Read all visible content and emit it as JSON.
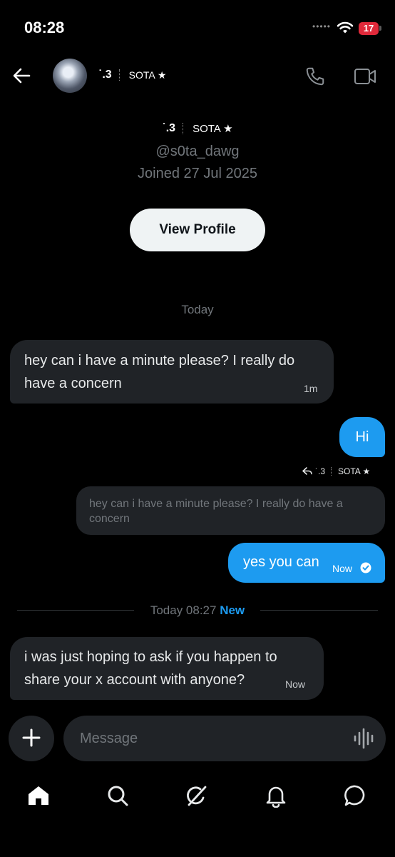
{
  "status_bar": {
    "time": "08:28",
    "battery": "17"
  },
  "header": {
    "name_part1": "˙.3",
    "name_part2": "SOTA ★"
  },
  "profile": {
    "name_part1": "˙.3",
    "name_part2": "SOTA ★",
    "handle": "@s0ta_dawg",
    "joined": "Joined 27 Jul 2025",
    "view_button": "View Profile"
  },
  "day_label": "Today",
  "messages": [
    {
      "text": "hey can i have a minute please? I really do have a concern",
      "time": "1m"
    },
    {
      "text": "Hi"
    },
    {
      "reply_to_name": "˙.3",
      "reply_to_name2": "SOTA ★",
      "quoted": "hey can i have a minute please? I really do have a concern",
      "text": "yes you can",
      "time": "Now"
    },
    {
      "text": "i was just hoping to ask if you happen to share your x account with anyone?",
      "time": "Now"
    }
  ],
  "divider": {
    "label": "Today 08:27",
    "new": "New"
  },
  "composer": {
    "placeholder": "Message"
  },
  "colors": {
    "accent": "#1d9bf0",
    "bubble_in": "#202327",
    "background": "#000000"
  },
  "icons": [
    "back-arrow-icon",
    "phone-icon",
    "video-icon",
    "plus-icon",
    "voice-wave-icon",
    "home-icon",
    "search-icon",
    "grok-icon",
    "bell-icon",
    "messages-icon"
  ]
}
